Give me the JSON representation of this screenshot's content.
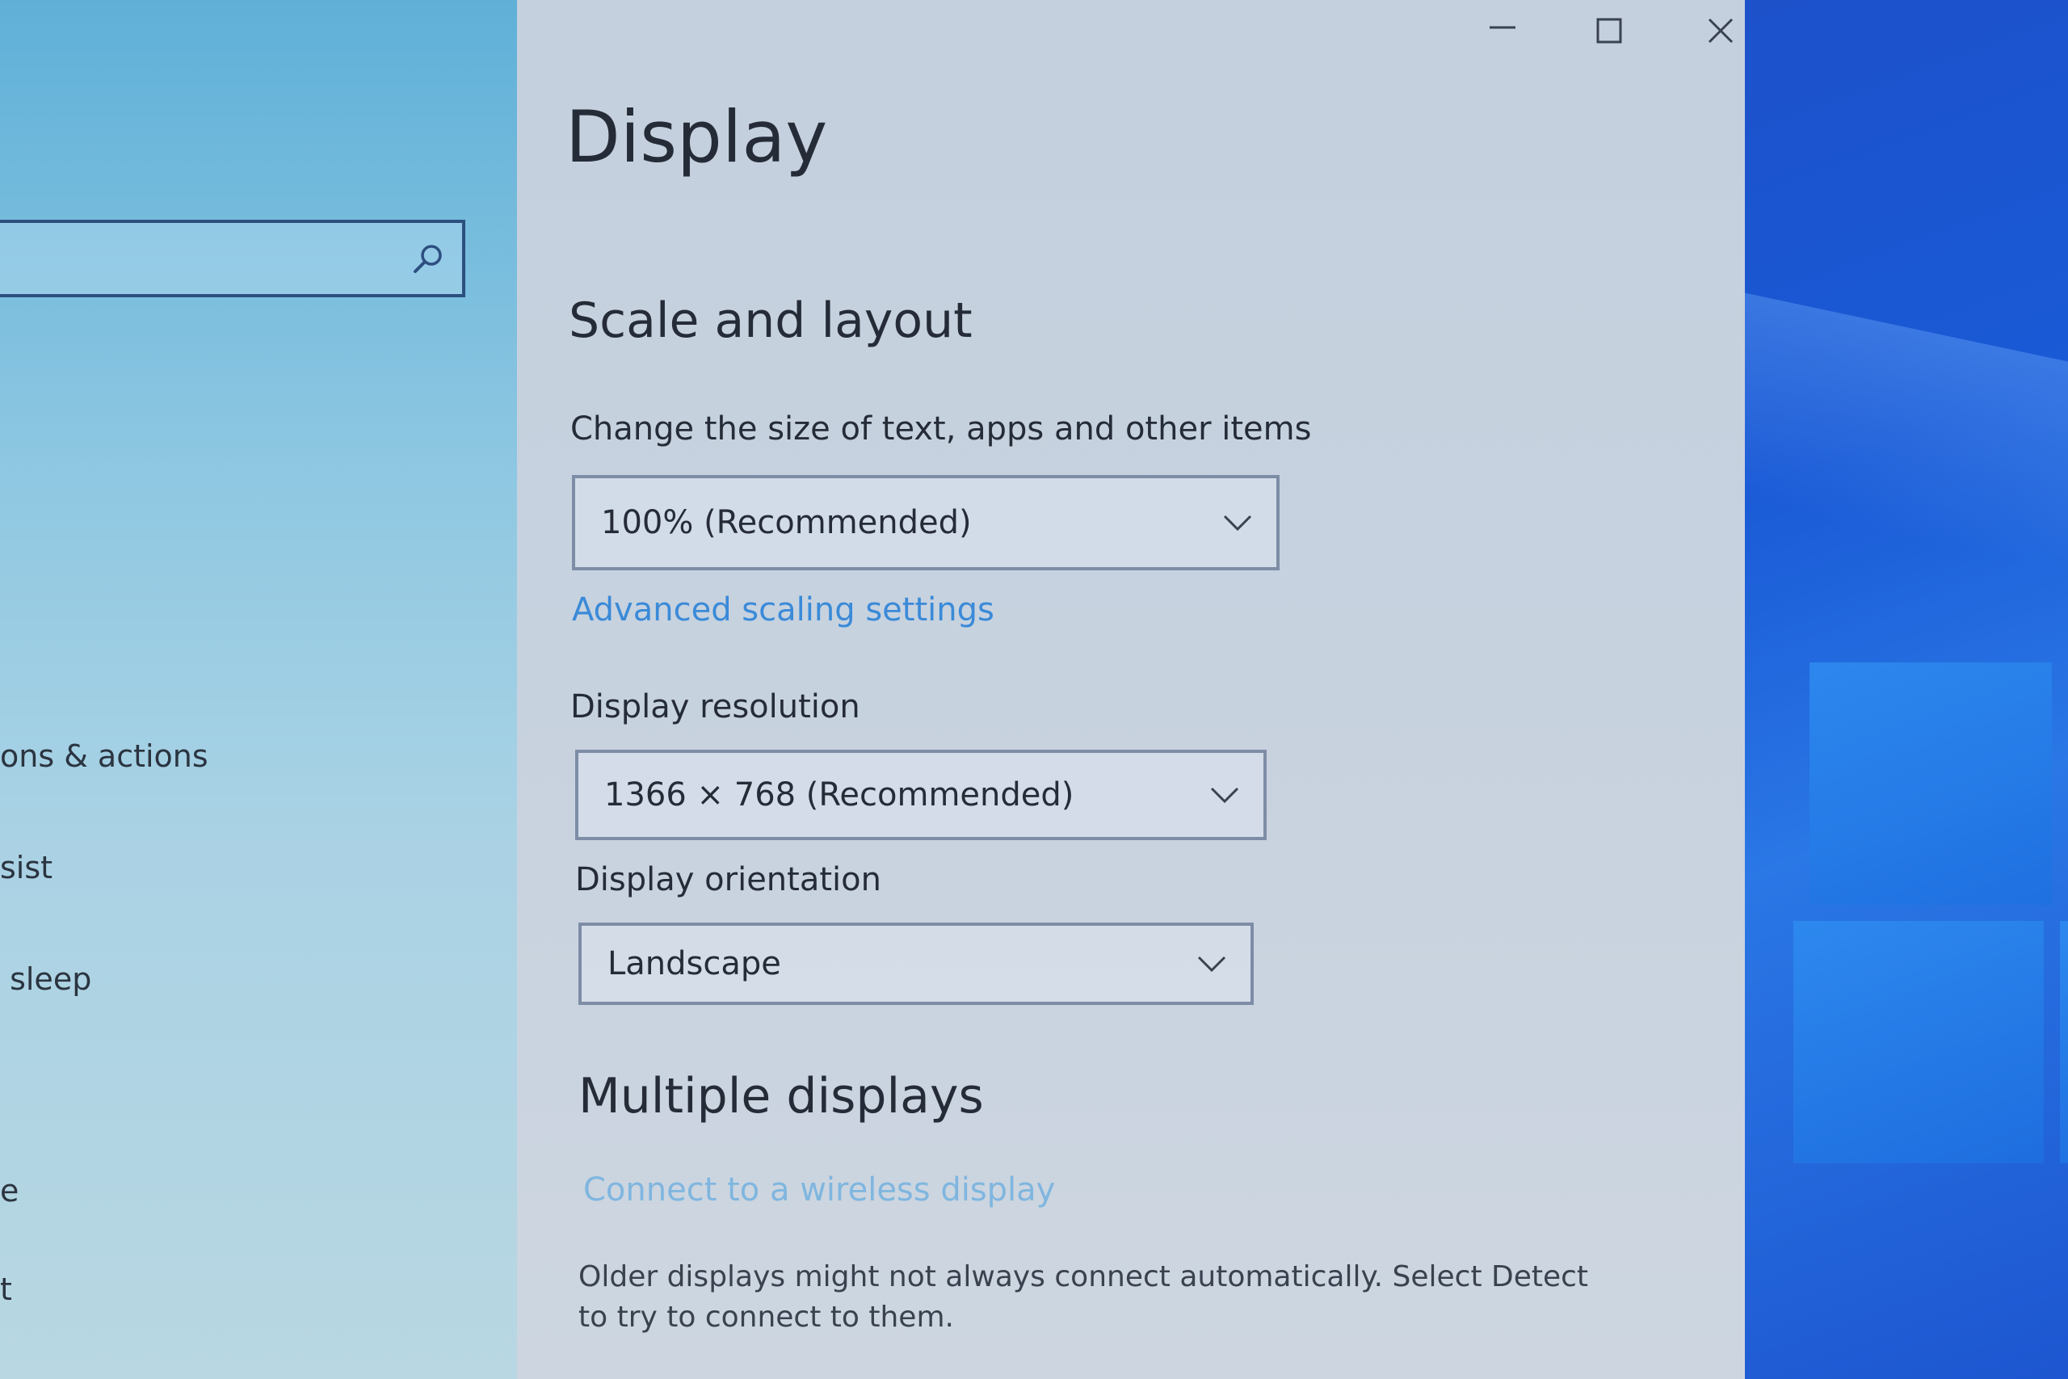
{
  "window": {
    "controls": {
      "minimize": "—",
      "maximize": "☐",
      "close": "✕"
    }
  },
  "nav": {
    "search_placeholder": "",
    "items": [
      {
        "label": "ons & actions"
      },
      {
        "label": "sist"
      },
      {
        "label": " sleep"
      },
      {
        "label": "e"
      },
      {
        "label": "t"
      }
    ]
  },
  "main": {
    "page_title": "Display",
    "scale_section": {
      "title": "Scale and layout",
      "size_label": "Change the size of text, apps and other items",
      "size_value": "100% (Recommended)",
      "advanced_link": "Advanced scaling settings",
      "resolution_label": "Display resolution",
      "resolution_value": "1366 × 768 (Recommended)",
      "orientation_label": "Display orientation",
      "orientation_value": "Landscape"
    },
    "multiple_section": {
      "title": "Multiple displays",
      "wireless_link": "Connect to a wireless display",
      "description": "Older displays might not always connect automatically. Select Detect to try to connect to them."
    }
  },
  "colors": {
    "accent_link": "#3a8ad8",
    "text": "#252c38",
    "wallpaper": "#1a5ad6"
  }
}
